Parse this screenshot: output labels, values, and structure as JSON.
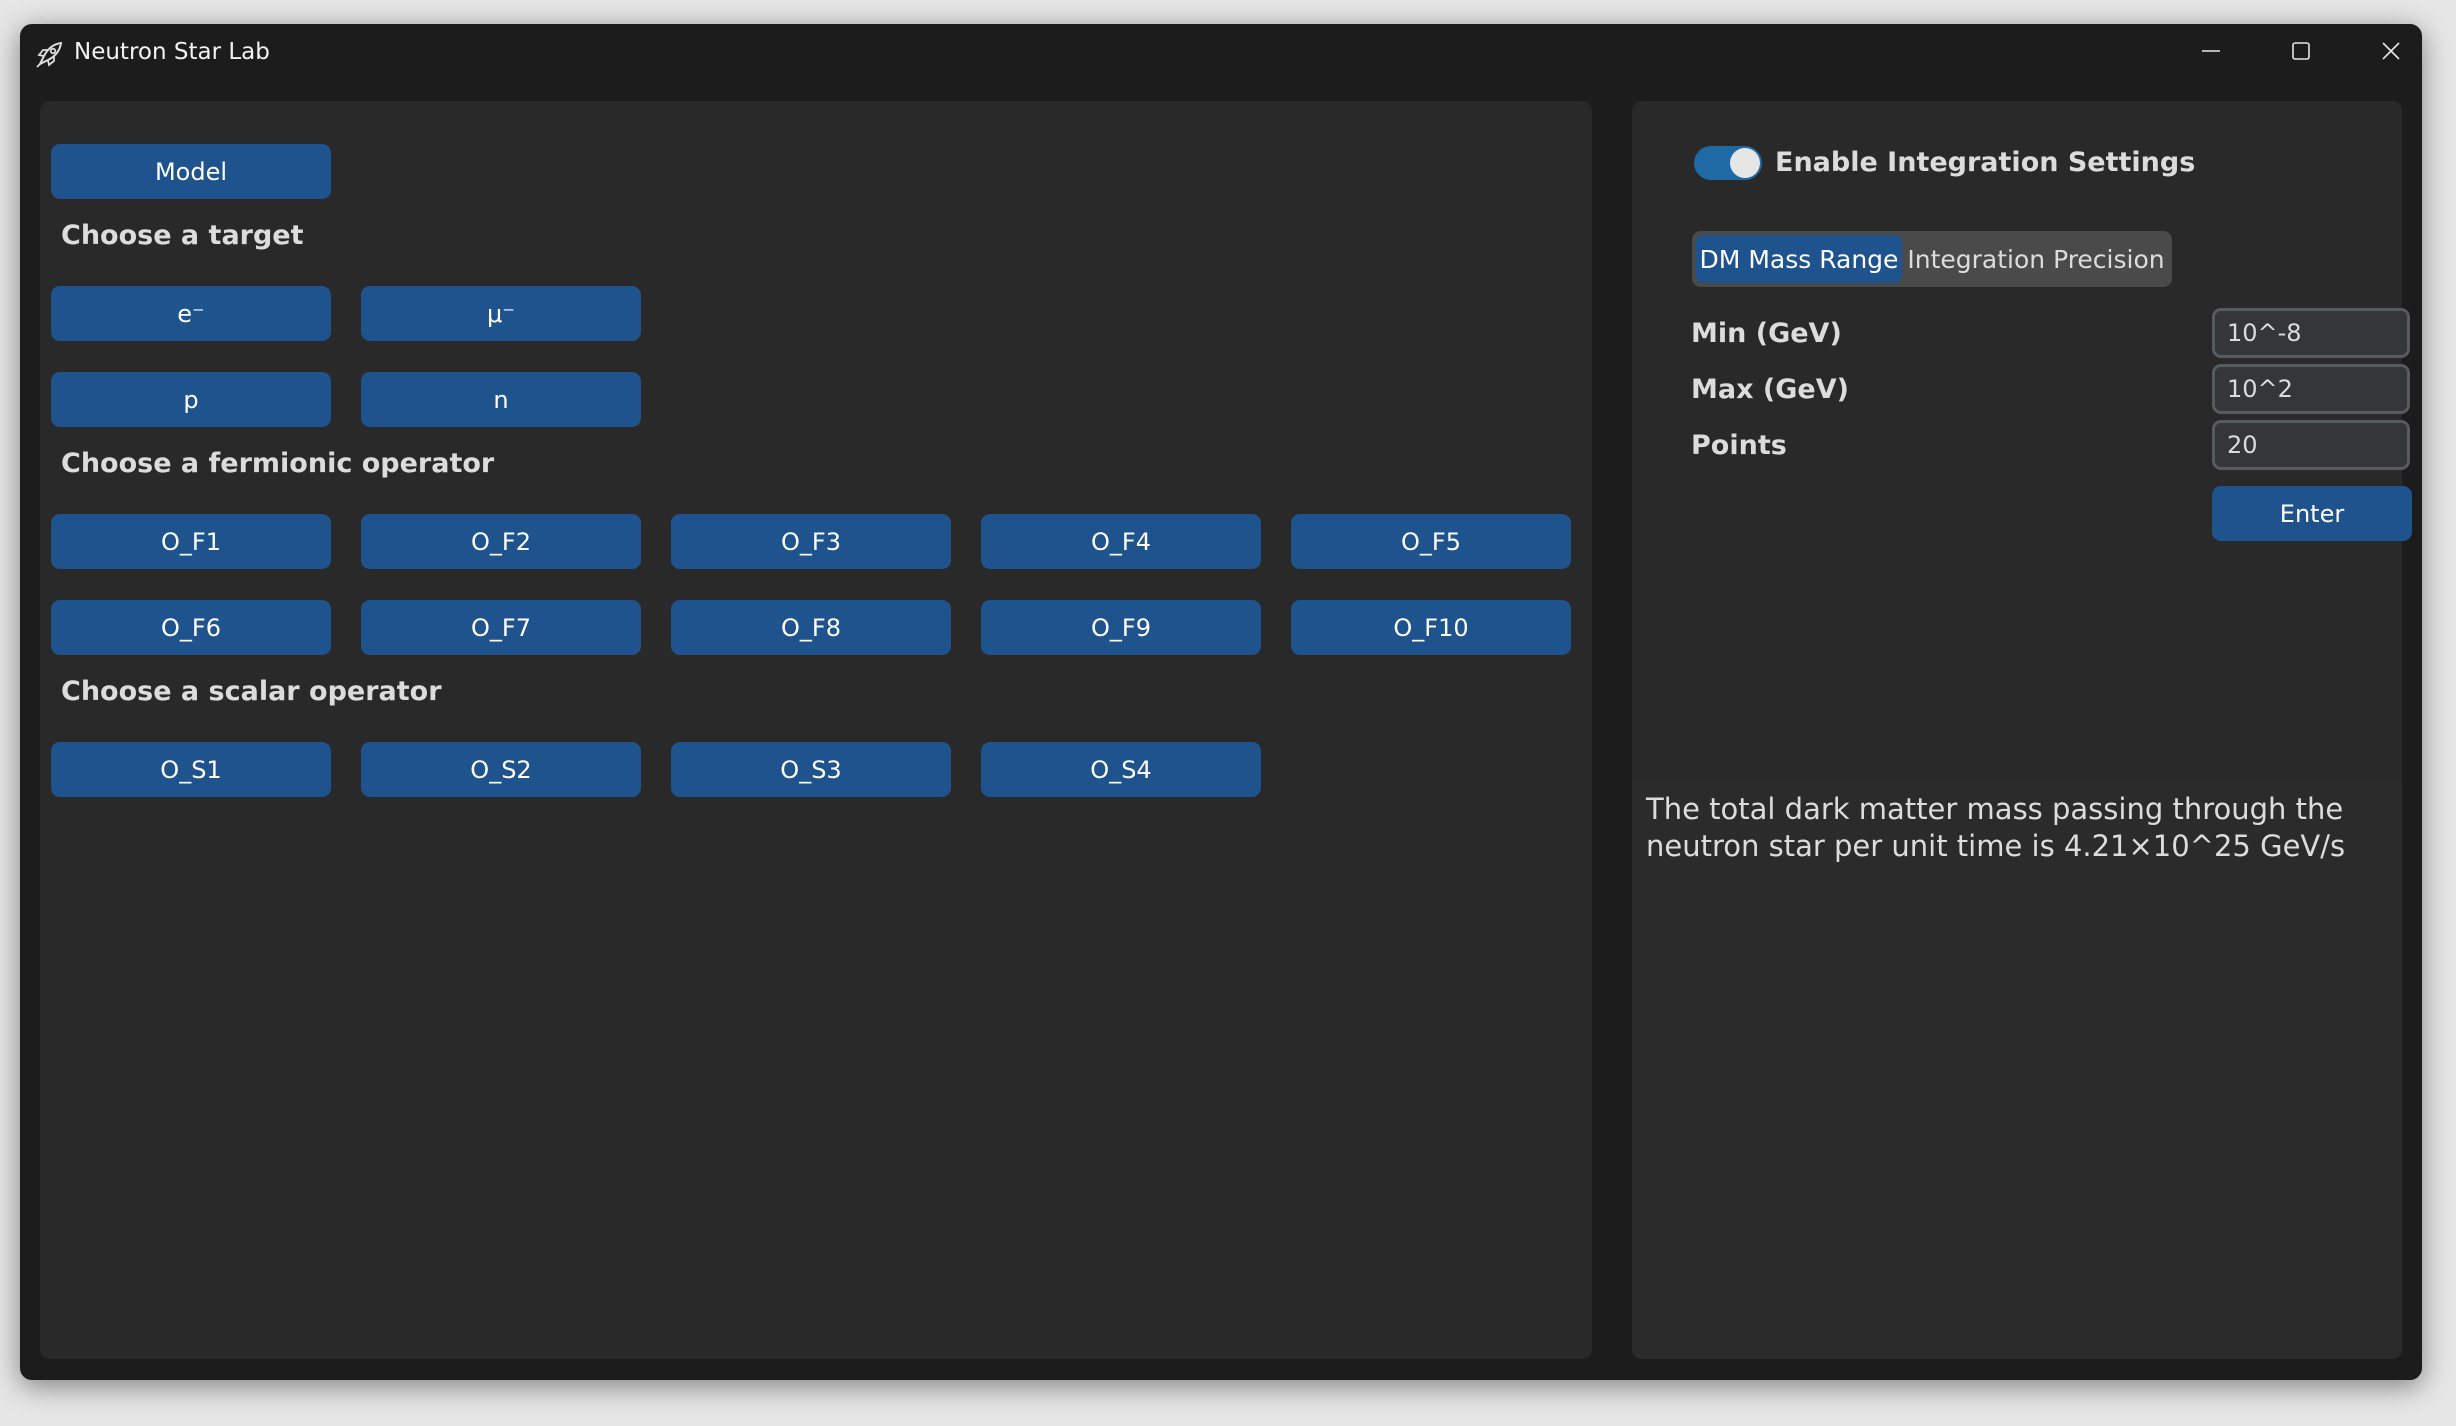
{
  "window": {
    "title": "Neutron Star Lab",
    "icon": "rocket-icon"
  },
  "left": {
    "model_button": "Model",
    "target_heading": "Choose a target",
    "targets": [
      "e⁻",
      "μ⁻",
      "p",
      "n"
    ],
    "fermionic_heading": "Choose a fermionic operator",
    "fermionic_ops": [
      "O_F1",
      "O_F2",
      "O_F3",
      "O_F4",
      "O_F5",
      "O_F6",
      "O_F7",
      "O_F8",
      "O_F9",
      "O_F10"
    ],
    "scalar_heading": "Choose a scalar operator",
    "scalar_ops": [
      "O_S1",
      "O_S2",
      "O_S3",
      "O_S4"
    ]
  },
  "right": {
    "toggle_label": "Enable Integration Settings",
    "toggle_on": true,
    "tabs": [
      "DM Mass Range",
      "Integration Precision"
    ],
    "active_tab": "DM Mass Range",
    "fields": {
      "min_label": "Min (GeV)",
      "min_value": "10^-8",
      "max_label": "Max (GeV)",
      "max_value": "10^2",
      "points_label": "Points",
      "points_value": "20"
    },
    "enter_button": "Enter",
    "output_text": "The total dark matter mass passing through the neutron star per unit time is 4.21×10^25 GeV/s"
  },
  "colors": {
    "accent": "#1f538d",
    "toggle": "#1f6aa5",
    "panel": "#292929",
    "window": "#1c1c1c"
  }
}
